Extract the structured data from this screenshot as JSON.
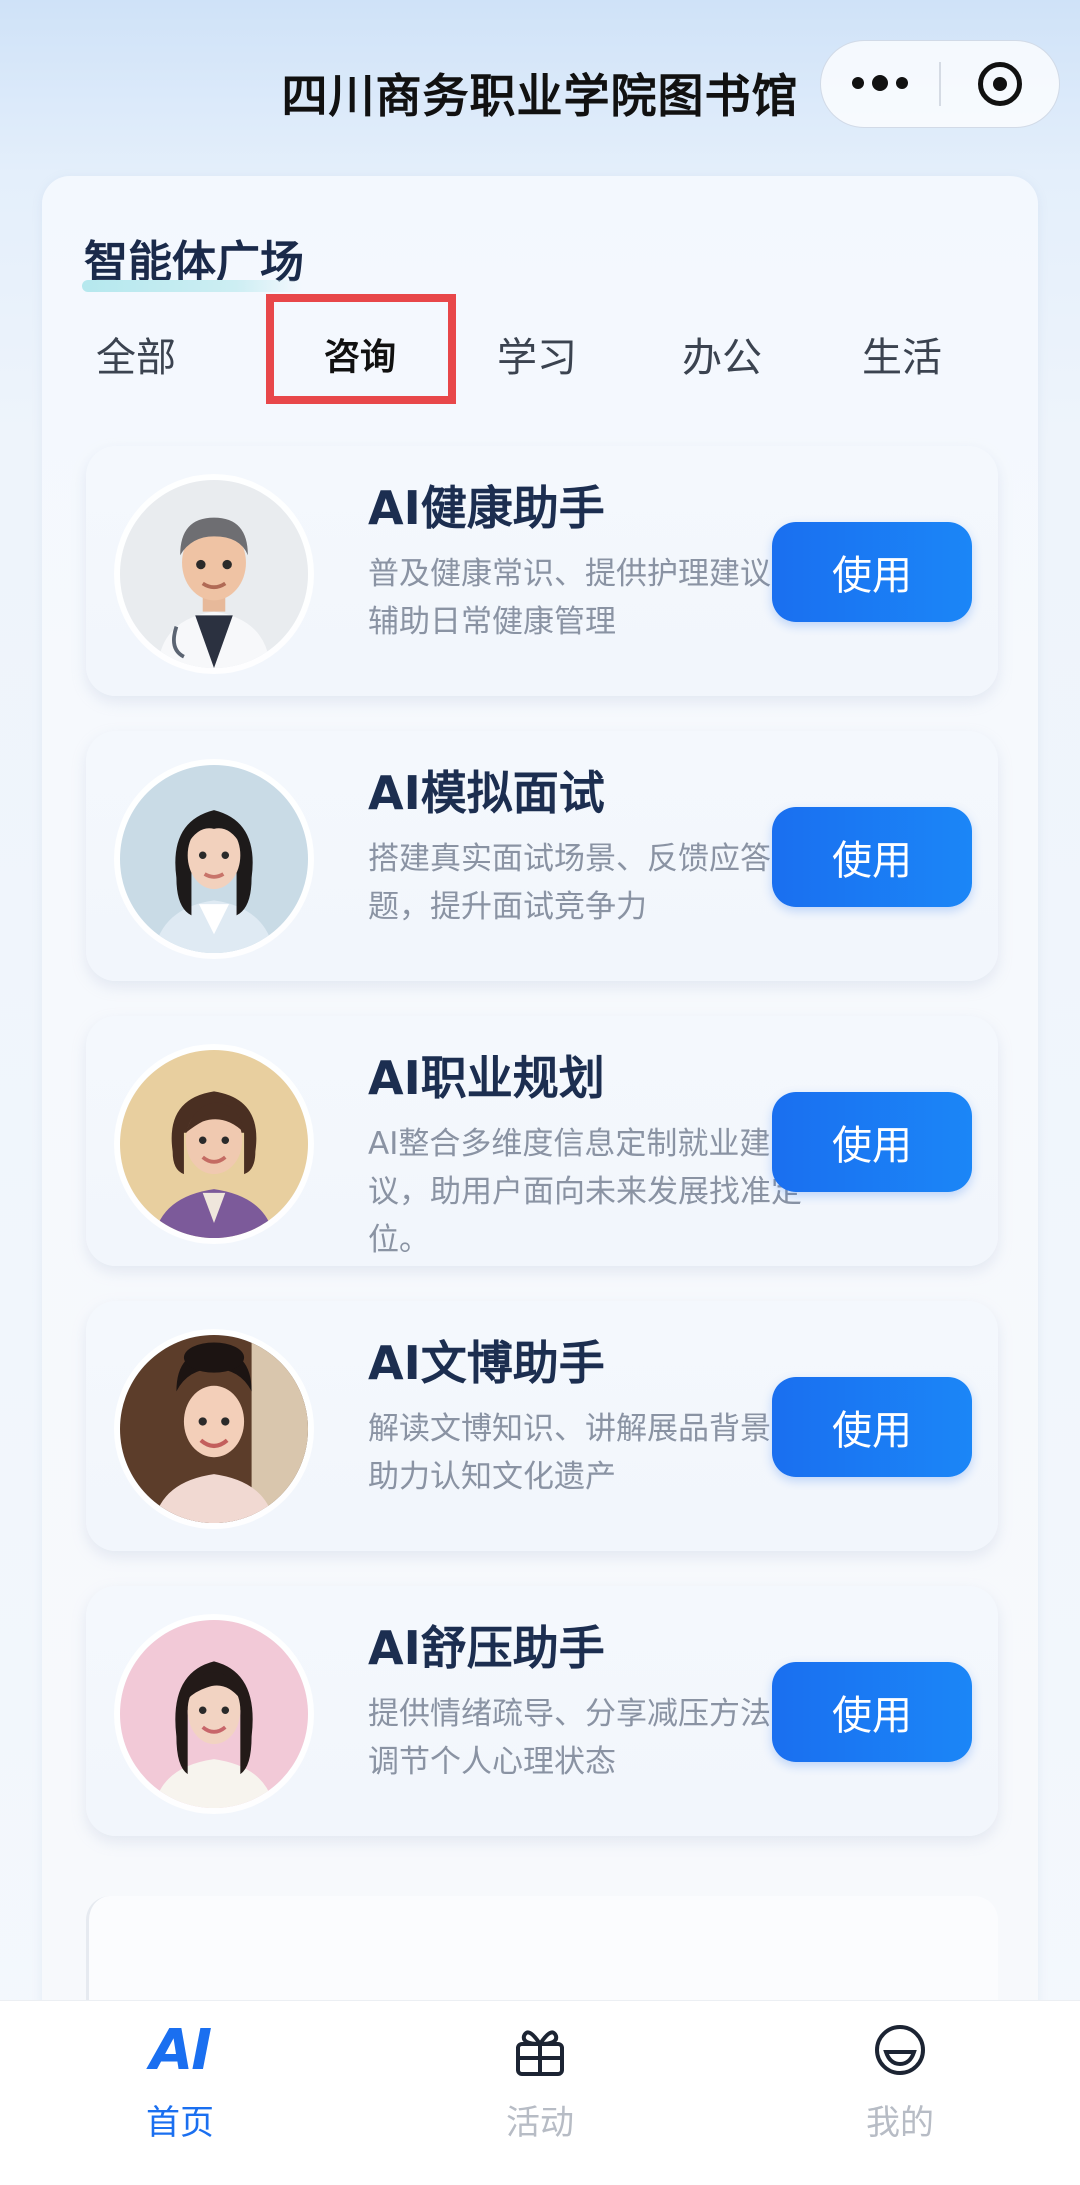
{
  "header": {
    "title": "四川商务职业学院图书馆",
    "more_icon": "more-dots-icon",
    "close_icon": "target-circle-icon"
  },
  "section": {
    "title": "智能体广场"
  },
  "tabs": [
    {
      "label": "全部",
      "active": false
    },
    {
      "label": "咨询",
      "active": true
    },
    {
      "label": "学习",
      "active": false
    },
    {
      "label": "办公",
      "active": false
    },
    {
      "label": "生活",
      "active": false
    }
  ],
  "agents": [
    {
      "title": "AI健康助手",
      "desc": "普及健康常识、提供护理建议，辅助日常健康管理",
      "button": "使用"
    },
    {
      "title": "AI模拟面试",
      "desc": "搭建真实面试场景、反馈应答问题，提升面试竞争力",
      "button": "使用"
    },
    {
      "title": "AI职业规划",
      "desc": "AI整合多维度信息定制就业建议，助用户面向未来发展找准定位。",
      "button": "使用"
    },
    {
      "title": "AI文博助手",
      "desc": "解读文博知识、讲解展品背景，助力认知文化遗产",
      "button": "使用"
    },
    {
      "title": "AI舒压助手",
      "desc": "提供情绪疏导、分享减压方法，调节个人心理状态",
      "button": "使用"
    }
  ],
  "nav": [
    {
      "label": "首页",
      "icon": "ai-logo-icon",
      "logo_text": "AI",
      "active": true
    },
    {
      "label": "活动",
      "icon": "gift-icon",
      "active": false
    },
    {
      "label": "我的",
      "icon": "smile-face-icon",
      "active": false
    }
  ],
  "colors": {
    "accent": "#1a6ff0",
    "highlight_box": "#e8474a"
  }
}
